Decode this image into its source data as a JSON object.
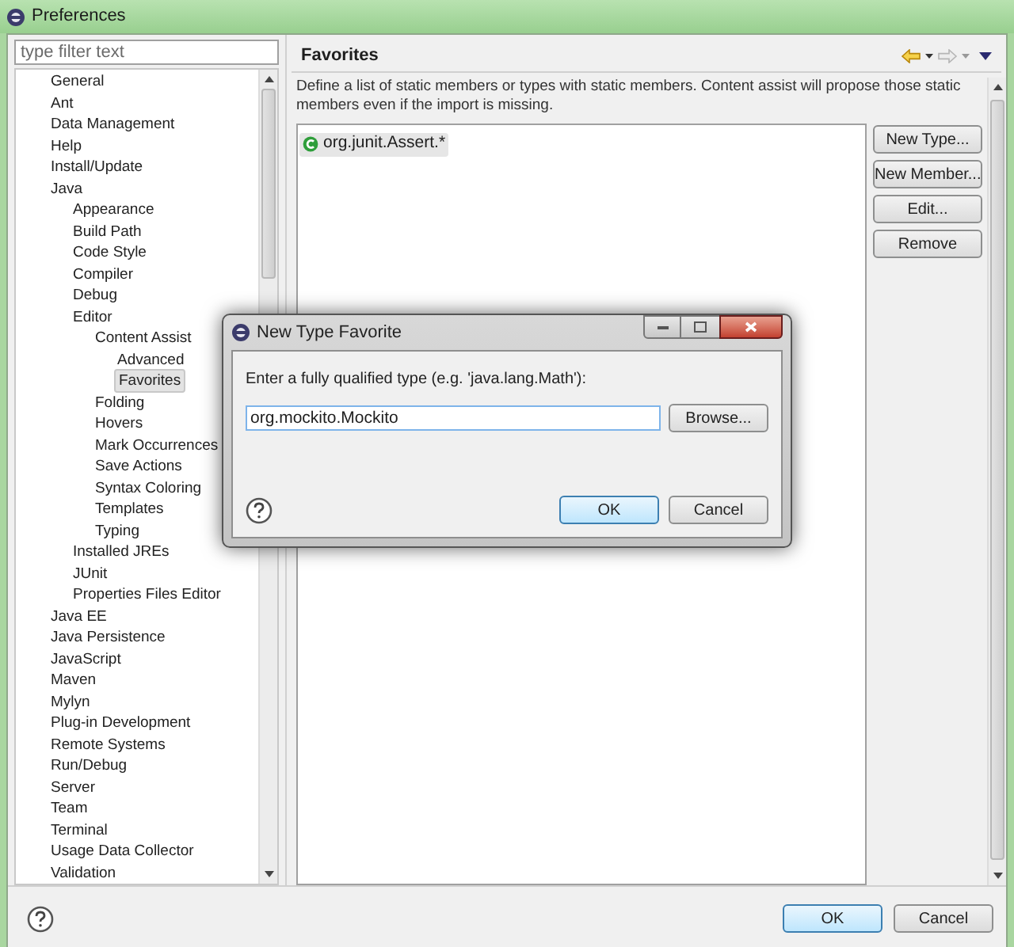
{
  "window": {
    "title": "Preferences"
  },
  "filter": {
    "placeholder": "type filter text"
  },
  "tree": [
    {
      "label": "General",
      "selected": false
    },
    {
      "label": "Ant",
      "selected": false
    },
    {
      "label": "Data Management",
      "selected": false
    },
    {
      "label": "Help",
      "selected": false
    },
    {
      "label": "Install/Update",
      "selected": false
    },
    {
      "label": "Java",
      "selected": false,
      "children": [
        {
          "label": "Appearance",
          "selected": false
        },
        {
          "label": "Build Path",
          "selected": false
        },
        {
          "label": "Code Style",
          "selected": false
        },
        {
          "label": "Compiler",
          "selected": false
        },
        {
          "label": "Debug",
          "selected": false
        },
        {
          "label": "Editor",
          "selected": false,
          "children": [
            {
              "label": "Content Assist",
              "selected": false,
              "children": [
                {
                  "label": "Advanced",
                  "selected": false
                },
                {
                  "label": "Favorites",
                  "selected": true
                }
              ]
            },
            {
              "label": "Folding",
              "selected": false
            },
            {
              "label": "Hovers",
              "selected": false
            },
            {
              "label": "Mark Occurrences",
              "selected": false
            },
            {
              "label": "Save Actions",
              "selected": false
            },
            {
              "label": "Syntax Coloring",
              "selected": false
            },
            {
              "label": "Templates",
              "selected": false
            },
            {
              "label": "Typing",
              "selected": false
            }
          ]
        },
        {
          "label": "Installed JREs",
          "selected": false
        },
        {
          "label": "JUnit",
          "selected": false
        },
        {
          "label": "Properties Files Editor",
          "selected": false
        }
      ]
    },
    {
      "label": "Java EE",
      "selected": false
    },
    {
      "label": "Java Persistence",
      "selected": false
    },
    {
      "label": "JavaScript",
      "selected": false
    },
    {
      "label": "Maven",
      "selected": false
    },
    {
      "label": "Mylyn",
      "selected": false
    },
    {
      "label": "Plug-in Development",
      "selected": false
    },
    {
      "label": "Remote Systems",
      "selected": false
    },
    {
      "label": "Run/Debug",
      "selected": false
    },
    {
      "label": "Server",
      "selected": false
    },
    {
      "label": "Team",
      "selected": false
    },
    {
      "label": "Terminal",
      "selected": false
    },
    {
      "label": "Usage Data Collector",
      "selected": false
    },
    {
      "label": "Validation",
      "selected": false
    }
  ],
  "page": {
    "title": "Favorites",
    "description": "Define a list of static members or types with static members. Content assist will propose those static members even if the import is missing.",
    "favorites": [
      {
        "label": "org.junit.Assert.*",
        "selected": true
      }
    ],
    "buttons": [
      "New Type...",
      "New Member...",
      "Edit...",
      "Remove"
    ]
  },
  "footer_buttons": [
    {
      "label": "OK",
      "default": true
    },
    {
      "label": "Cancel",
      "default": false
    }
  ],
  "dialog": {
    "title": "New Type Favorite",
    "prompt": "Enter a fully qualified type (e.g. 'java.lang.Math'):",
    "value": "org.mockito.Mockito",
    "browse": "Browse...",
    "buttons": [
      {
        "label": "OK",
        "default": true
      },
      {
        "label": "Cancel",
        "default": false
      }
    ]
  }
}
